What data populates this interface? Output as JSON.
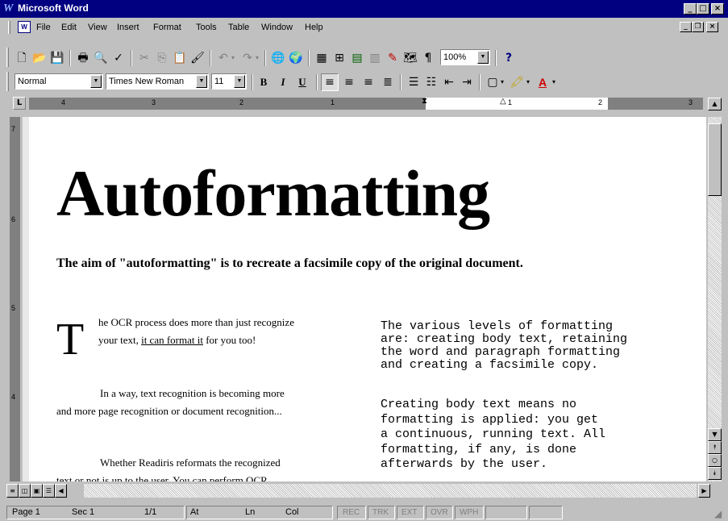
{
  "window": {
    "title": "Microsoft Word",
    "app_icon": "W"
  },
  "menu": {
    "items": [
      "File",
      "Edit",
      "View",
      "Insert",
      "Format",
      "Tools",
      "Table",
      "Window",
      "Help"
    ]
  },
  "standard_toolbar": {
    "zoom": "100%"
  },
  "formatting_toolbar": {
    "style": "Normal",
    "font": "Times New Roman",
    "size": "11",
    "bold_label": "B",
    "italic_label": "I",
    "underline_label": "U"
  },
  "ruler": {
    "numbers": [
      "4",
      "3",
      "2",
      "1",
      "1",
      "2",
      "3"
    ]
  },
  "vertical_ruler": {
    "numbers": [
      "7",
      "6",
      "5",
      "4"
    ]
  },
  "document": {
    "title": "Autoformatting",
    "subtitle": "The aim of \"autoformatting\" is to recreate a facsimile copy of the original document.",
    "left_column": {
      "dropcap": "T",
      "p1_line1": "he OCR process does more than just recognize",
      "p1_line2_a": "your text, ",
      "p1_line2_link": "it can format it",
      "p1_line2_b": " for you too!",
      "p2_line1": "In a way, text recognition is becoming more",
      "p2_line2": "and more page recognition or document recognition...",
      "p3_line1": "Whether Readiris reformats the recognized",
      "p3_line2": "text or not is up to the user. You can perform OCR"
    },
    "right_column": {
      "p1": "The various levels of formatting\nare: creating body text, retaining\nthe word and paragraph formatting\nand creating a facsimile copy.",
      "p2": "Creating body text means no\nformatting is applied: you get\na continuous, running text. All\nformatting, if any, is done\nafterwards by the user."
    }
  },
  "status": {
    "page": "Page 1",
    "sec": "Sec 1",
    "pages": "1/1",
    "at": "At",
    "ln": "Ln",
    "col": "Col",
    "rec": "REC",
    "trk": "TRK",
    "ext": "EXT",
    "ovr": "OVR",
    "wph": "WPH"
  }
}
